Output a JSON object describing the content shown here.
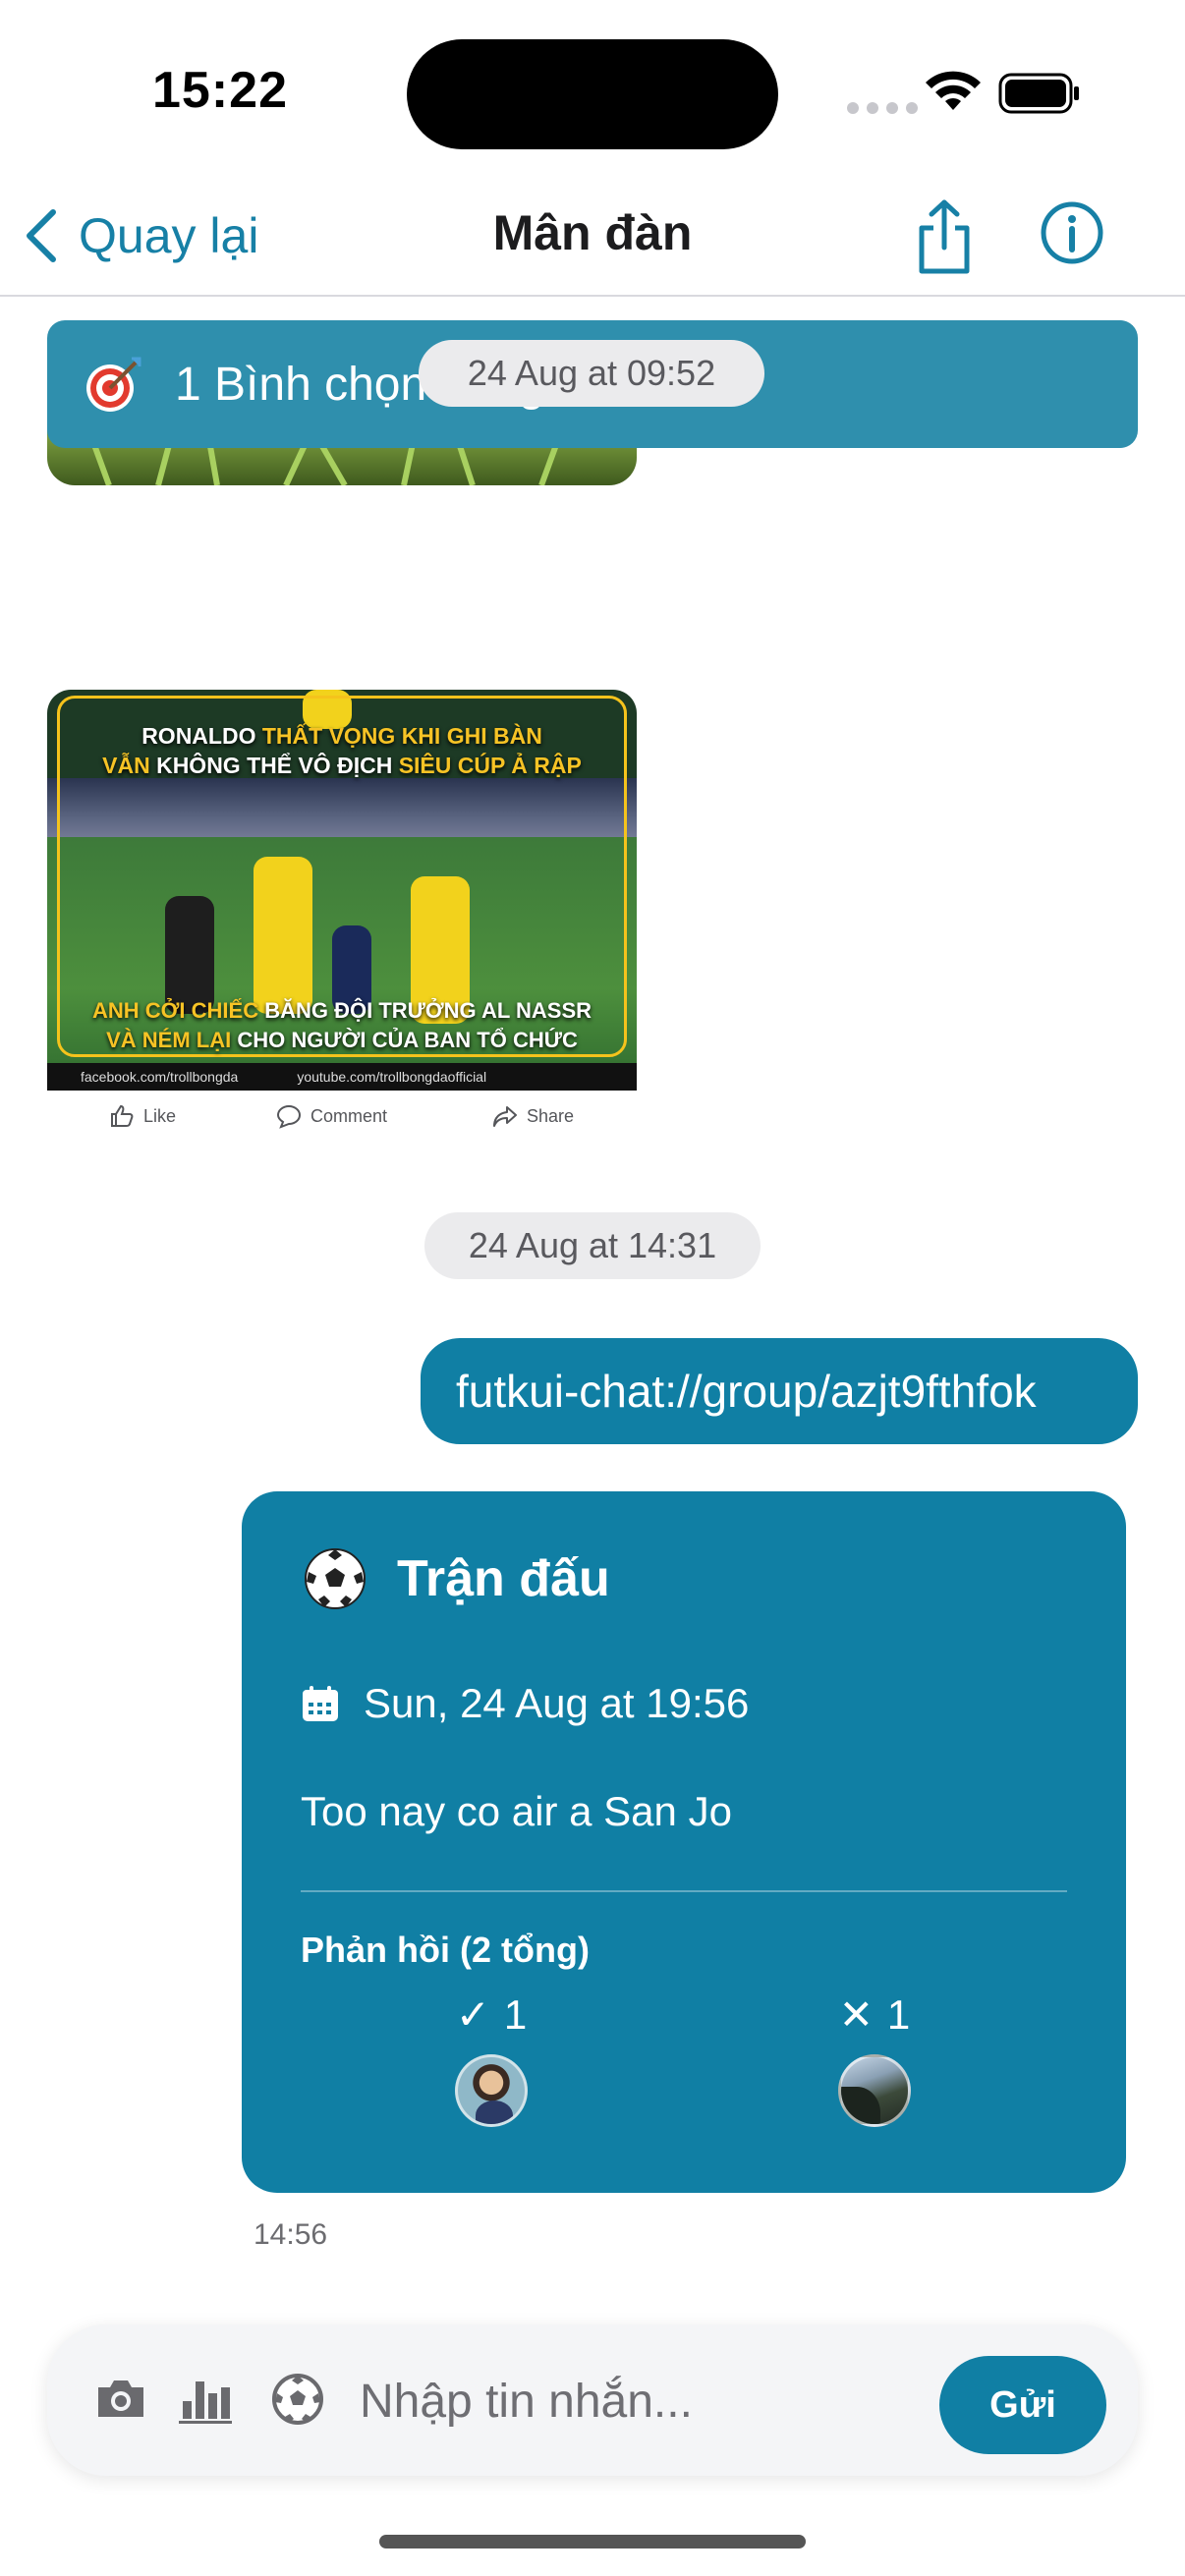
{
  "status_bar": {
    "time": "15:22"
  },
  "nav": {
    "back_label": "Quay lại",
    "title": "Mân đàn"
  },
  "poll_banner": {
    "text": "1 Bình chọn đang chờ"
  },
  "messages": {
    "date_1": "24 Aug at 09:52",
    "meme": {
      "top_line1_a": "RONALDO ",
      "top_line1_b": "THẤT VỌNG KHI GHI BÀN",
      "top_line2_a": "VẪN ",
      "top_line2_b": "KHÔNG THỂ VÔ ĐỊCH ",
      "top_line2_c": "SIÊU CÚP Ả RẬP",
      "bottom_line1_a": "ANH CỞI CHIẾC ",
      "bottom_line1_b": "BĂNG ĐỘI TRƯỞNG AL NASSR",
      "bottom_line2_a": "VÀ NÉM LẠI ",
      "bottom_line2_b": "CHO NGƯỜI CỦA BAN TỔ CHỨC",
      "footer_facebook": "facebook.com/trollbongda",
      "footer_youtube": "youtube.com/trollbongdaofficial"
    },
    "social": {
      "like": "Like",
      "comment": "Comment",
      "share": "Share"
    },
    "date_2": "24 Aug at 14:31",
    "link_text": "futkui-chat://group/azjt9fthfok",
    "match_card": {
      "title": "Trận đấu",
      "datetime": "Sun, 24 Aug at 19:56",
      "note": "Too nay co air a San Jo",
      "responses_label": "Phản hồi (2 tổng)",
      "yes_symbol": "✓",
      "yes_count": "1",
      "no_symbol": "✕",
      "no_count": "1"
    },
    "match_time": "14:56"
  },
  "composer": {
    "placeholder": "Nhập tin nhắn...",
    "send_label": "Gửi"
  },
  "colors": {
    "accent": "#107fa4",
    "banner": "#2f8fad",
    "link": "#1780a6"
  },
  "icons": [
    "chevron-left-icon",
    "share-icon",
    "info-icon",
    "target-icon",
    "soccer-ball-icon",
    "calendar-icon",
    "camera-icon",
    "bar-chart-icon",
    "wifi-icon",
    "battery-icon"
  ]
}
